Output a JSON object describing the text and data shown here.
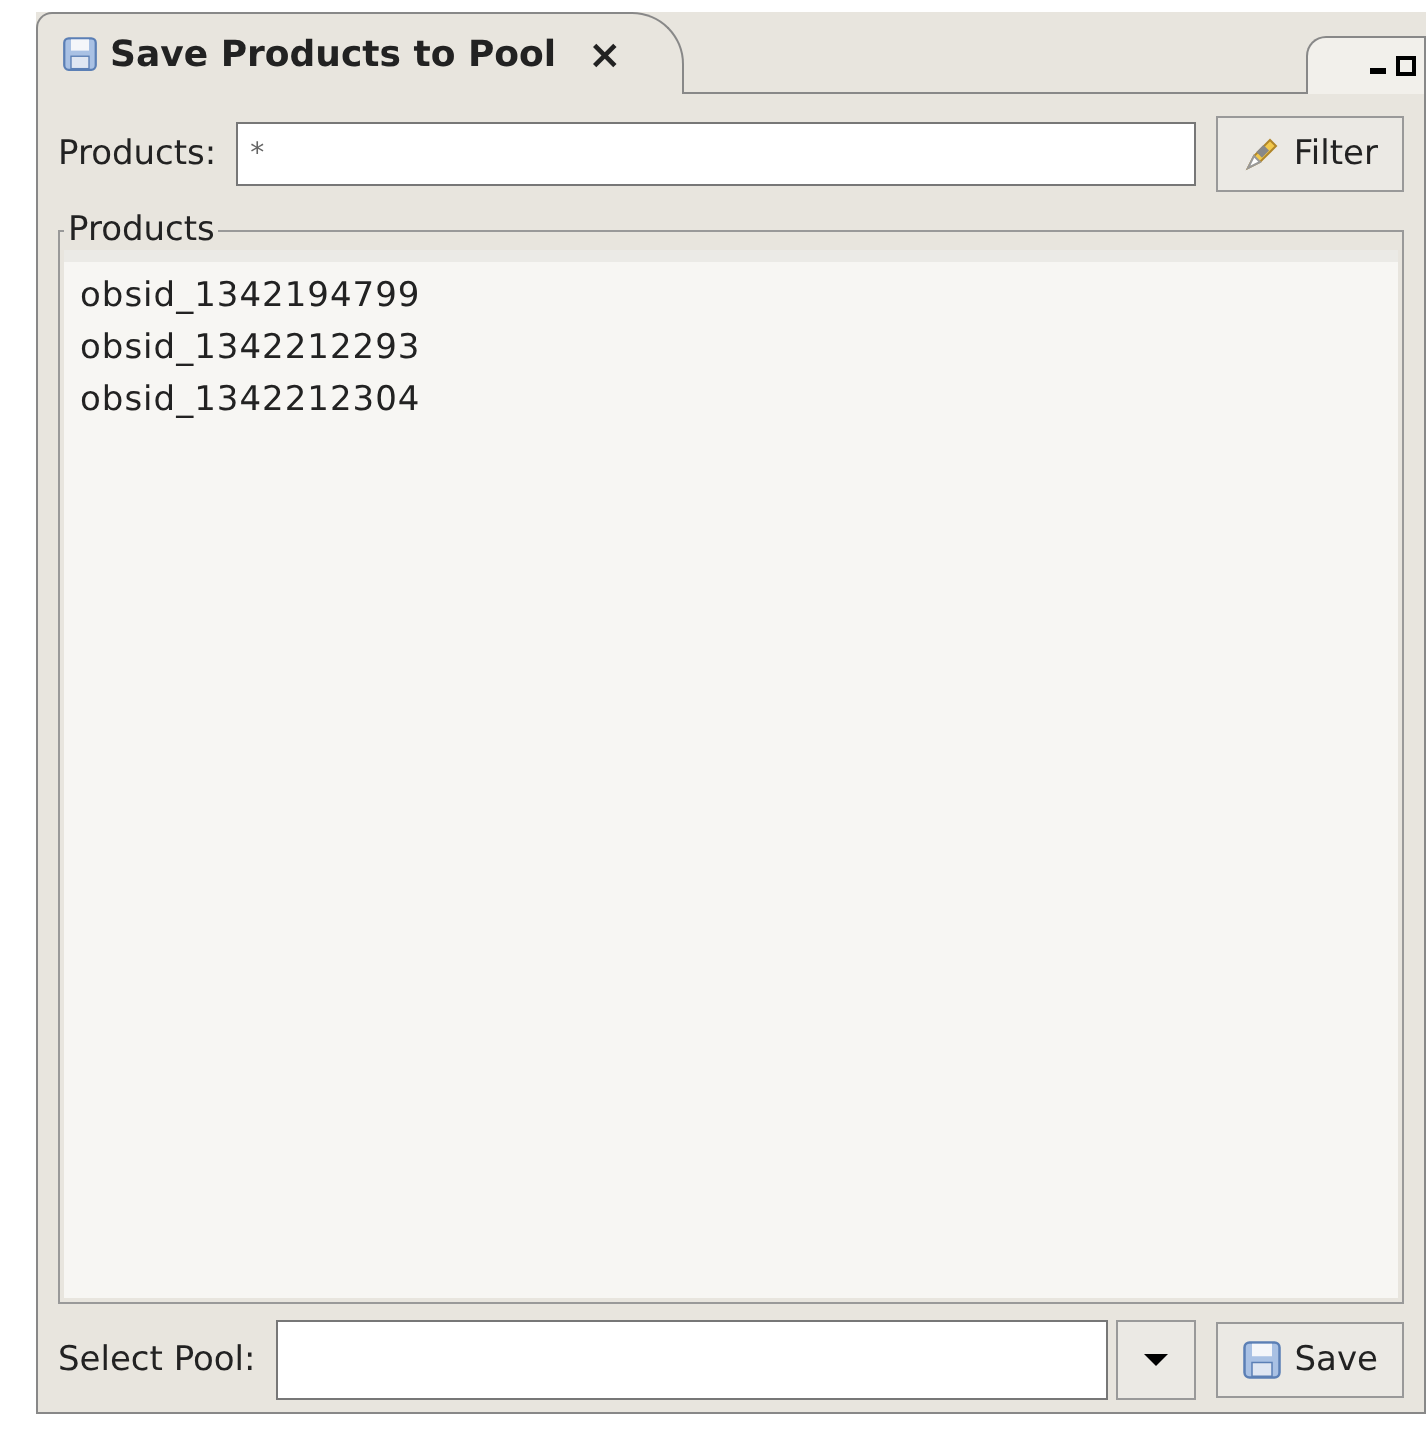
{
  "tab": {
    "title": "Save Products to Pool",
    "close": "×"
  },
  "filter": {
    "label": "Products:",
    "value": "*",
    "button": "Filter"
  },
  "products": {
    "title": "Products",
    "items": [
      "obsid_1342194799",
      "obsid_1342212293",
      "obsid_1342212304"
    ]
  },
  "pool": {
    "label": "Select Pool:",
    "button": "Save"
  }
}
